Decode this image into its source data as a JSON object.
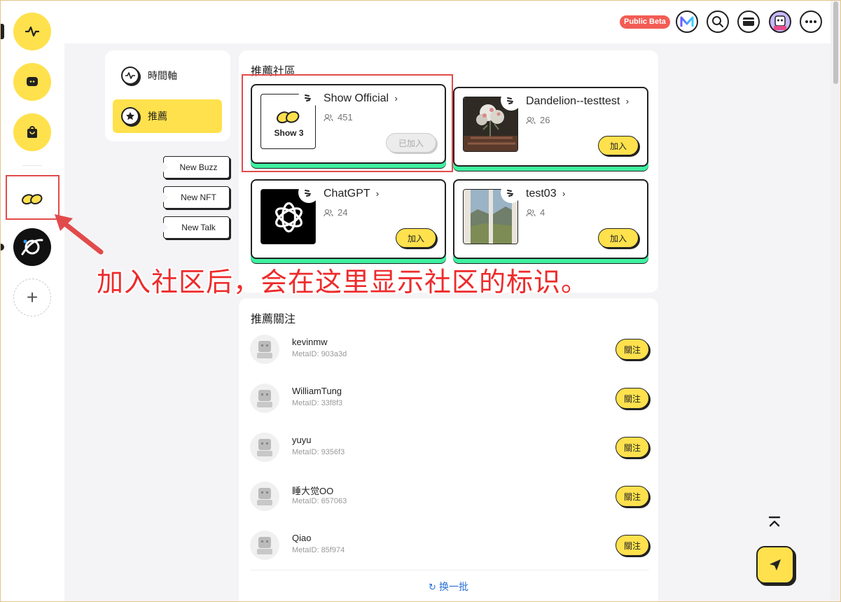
{
  "topbar": {
    "beta_badge": "Public Beta",
    "icons": [
      "metaid-logo-icon",
      "search-icon",
      "wallet-icon",
      "user-avatar-icon",
      "more-icon"
    ]
  },
  "rail": {
    "items": [
      "activity-icon",
      "chat-icon",
      "shop-icon",
      "show3-community-icon",
      "orbit-community-icon",
      "add-icon"
    ]
  },
  "nav": {
    "items": [
      {
        "label": "時間軸",
        "icon": "activity-icon",
        "active": false
      },
      {
        "label": "推薦",
        "icon": "star-icon",
        "active": true
      }
    ]
  },
  "tags": [
    "New Buzz",
    "New NFT",
    "New Talk"
  ],
  "communities": {
    "title": "推薦社區",
    "items": [
      {
        "name": "Show Official",
        "members": "451",
        "button": "已加入",
        "joined": true,
        "thumb": "show3",
        "thumb_text": "Show 3"
      },
      {
        "name": "Dandelion--testtest",
        "members": "26",
        "button": "加入",
        "joined": false,
        "thumb": "flower-photo"
      },
      {
        "name": "ChatGPT",
        "members": "24",
        "button": "加入",
        "joined": false,
        "thumb": "openai"
      },
      {
        "name": "test03",
        "members": "4",
        "button": "加入",
        "joined": false,
        "thumb": "window-photo"
      }
    ]
  },
  "follows": {
    "title": "推薦關注",
    "items": [
      {
        "name": "kevinmw",
        "metaid": "MetaID: 903a3d",
        "button": "關注"
      },
      {
        "name": "WilliamTung",
        "metaid": "MetaID: 33f8f3",
        "button": "關注"
      },
      {
        "name": "yuyu",
        "metaid": "MetaID: 9356f3",
        "button": "關注"
      },
      {
        "name": "睡大觉OO",
        "metaid": "MetaID: 657063",
        "button": "關注"
      },
      {
        "name": "Qiao",
        "metaid": "MetaID: 85f974",
        "button": "關注"
      }
    ],
    "refresh": "换一批"
  },
  "annotation": "加入社区后，会在这里显示社区的标识。",
  "colors": {
    "accent": "#ffe14d",
    "green": "#3ef0a0",
    "beta": "#f25c54",
    "annotation": "#ee2b2b"
  }
}
